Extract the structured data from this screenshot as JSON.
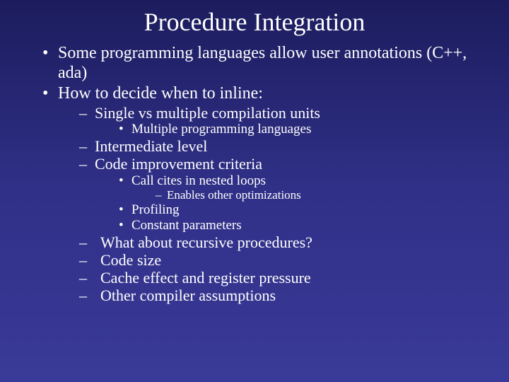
{
  "title": "Procedure Integration",
  "b1": "Some programming languages allow user annotations (C++, ada)",
  "b2": "How to decide when to inline:",
  "b2_s1": "Single vs multiple compilation units",
  "b2_s1_a": "Multiple programming languages",
  "b2_s2": "Intermediate level",
  "b2_s3": "Code improvement criteria",
  "b2_s3_a": "Call cites in nested loops",
  "b2_s3_a_i": "Enables other optimizations",
  "b2_s3_b": "Profiling",
  "b2_s3_c": "Constant parameters",
  "b2_s4": "What about recursive procedures?",
  "b2_s5": "Code size",
  "b2_s6": "Cache effect and register pressure",
  "b2_s7": "Other compiler assumptions"
}
